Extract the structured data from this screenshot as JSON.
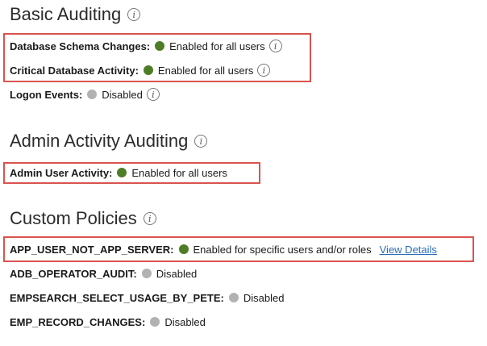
{
  "basic": {
    "title": "Basic Auditing",
    "items": [
      {
        "label": "Database Schema Changes:",
        "status": "Enabled for all users",
        "state": "enabled"
      },
      {
        "label": "Critical Database Activity:",
        "status": "Enabled for all users",
        "state": "enabled"
      },
      {
        "label": "Logon Events:",
        "status": "Disabled",
        "state": "disabled"
      }
    ]
  },
  "admin": {
    "title": "Admin Activity Auditing",
    "items": [
      {
        "label": "Admin User Activity:",
        "status": "Enabled for all users",
        "state": "enabled"
      }
    ]
  },
  "custom": {
    "title": "Custom Policies",
    "items": [
      {
        "label": "APP_USER_NOT_APP_SERVER:",
        "status": "Enabled for specific users and/or roles",
        "state": "enabled",
        "link": "View Details"
      },
      {
        "label": "ADB_OPERATOR_AUDIT:",
        "status": "Disabled",
        "state": "disabled"
      },
      {
        "label": "EMPSEARCH_SELECT_USAGE_BY_PETE:",
        "status": "Disabled",
        "state": "disabled"
      },
      {
        "label": "EMP_RECORD_CHANGES:",
        "status": "Disabled",
        "state": "disabled"
      }
    ]
  },
  "info_glyph": "i",
  "colors": {
    "enabled": "#4f7d27",
    "disabled": "#b2b2b2",
    "highlight": "#d9534f",
    "link": "#2a6ebb"
  },
  "icons": {
    "info": "info-icon",
    "status": "status-dot-icon"
  }
}
